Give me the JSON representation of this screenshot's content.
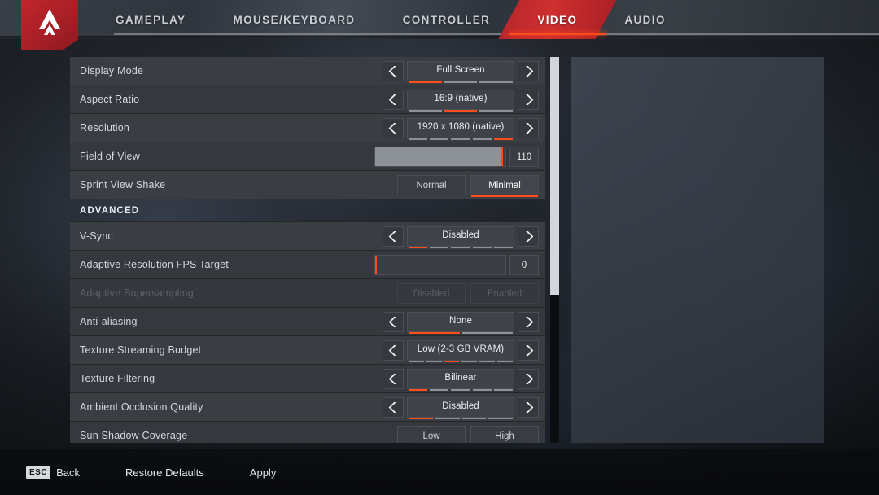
{
  "app": {
    "title": "Apex Legends Settings",
    "logo_icon": "apex-logo-icon"
  },
  "header": {
    "tabs": [
      {
        "label": "GAMEPLAY",
        "active": false
      },
      {
        "label": "MOUSE/KEYBOARD",
        "active": false
      },
      {
        "label": "CONTROLLER",
        "active": false
      },
      {
        "label": "VIDEO",
        "active": true
      },
      {
        "label": "AUDIO",
        "active": false
      }
    ]
  },
  "settings": {
    "section_basic_rows": [
      {
        "label": "Display Mode",
        "type": "selector",
        "value": "Full Screen",
        "segments": 3,
        "active_segment": 1,
        "prev_icon": "chevron-left-icon",
        "next_icon": "chevron-right-icon",
        "disabled": false
      },
      {
        "label": "Aspect Ratio",
        "type": "selector",
        "value": "16:9 (native)",
        "segments": 3,
        "active_segment": 2,
        "prev_icon": "chevron-left-icon",
        "next_icon": "chevron-right-icon",
        "disabled": false
      },
      {
        "label": "Resolution",
        "type": "selector",
        "value": "1920 x 1080 (native)",
        "segments": 5,
        "active_segment": 5,
        "prev_icon": "chevron-left-icon",
        "next_icon": "chevron-right-icon",
        "disabled": false
      },
      {
        "label": "Field of View",
        "type": "slider",
        "value": "110",
        "fill_percent": 97,
        "disabled": false
      },
      {
        "label": "Sprint View Shake",
        "type": "toggle",
        "options": [
          "Normal",
          "Minimal"
        ],
        "selected": "Minimal",
        "disabled": false
      }
    ],
    "advanced_header": "ADVANCED",
    "section_advanced_rows": [
      {
        "label": "V-Sync",
        "type": "selector",
        "value": "Disabled",
        "segments": 5,
        "active_segment": 1,
        "prev_icon": "chevron-left-icon",
        "next_icon": "chevron-right-icon",
        "disabled": false
      },
      {
        "label": "Adaptive Resolution FPS Target",
        "type": "slider",
        "value": "0",
        "fill_percent": 0,
        "disabled": false
      },
      {
        "label": "Adaptive Supersampling",
        "type": "toggle",
        "options": [
          "Disabled",
          "Enabled"
        ],
        "selected": "",
        "disabled": true
      },
      {
        "label": "Anti-aliasing",
        "type": "selector",
        "value": "None",
        "segments": 2,
        "active_segment": 1,
        "prev_icon": "chevron-left-icon",
        "next_icon": "chevron-right-icon",
        "disabled": false
      },
      {
        "label": "Texture Streaming Budget",
        "type": "selector",
        "value": "Low (2-3 GB VRAM)",
        "segments": 6,
        "active_segment": 3,
        "prev_icon": "chevron-left-icon",
        "next_icon": "chevron-right-icon",
        "disabled": false
      },
      {
        "label": "Texture Filtering",
        "type": "selector",
        "value": "Bilinear",
        "segments": 5,
        "active_segment": 1,
        "prev_icon": "chevron-left-icon",
        "next_icon": "chevron-right-icon",
        "disabled": false
      },
      {
        "label": "Ambient Occlusion Quality",
        "type": "selector",
        "value": "Disabled",
        "segments": 4,
        "active_segment": 1,
        "prev_icon": "chevron-left-icon",
        "next_icon": "chevron-right-icon",
        "disabled": false
      },
      {
        "label": "Sun Shadow Coverage",
        "type": "toggle",
        "options": [
          "Low",
          "High"
        ],
        "selected": "",
        "disabled": false
      }
    ]
  },
  "scrollbar": {
    "thumb_top_percent": 0,
    "thumb_height_percent": 61.6
  },
  "footer": {
    "items": [
      {
        "key": "ESC",
        "label": "Back"
      },
      {
        "key": "",
        "label": "Restore Defaults"
      },
      {
        "key": "",
        "label": "Apply"
      }
    ]
  },
  "colors": {
    "accent_orange": "#ff4d1c",
    "brand_red": "#b5252b",
    "row_bg": "#3a3d42",
    "segment_inactive": "#8d9298"
  }
}
